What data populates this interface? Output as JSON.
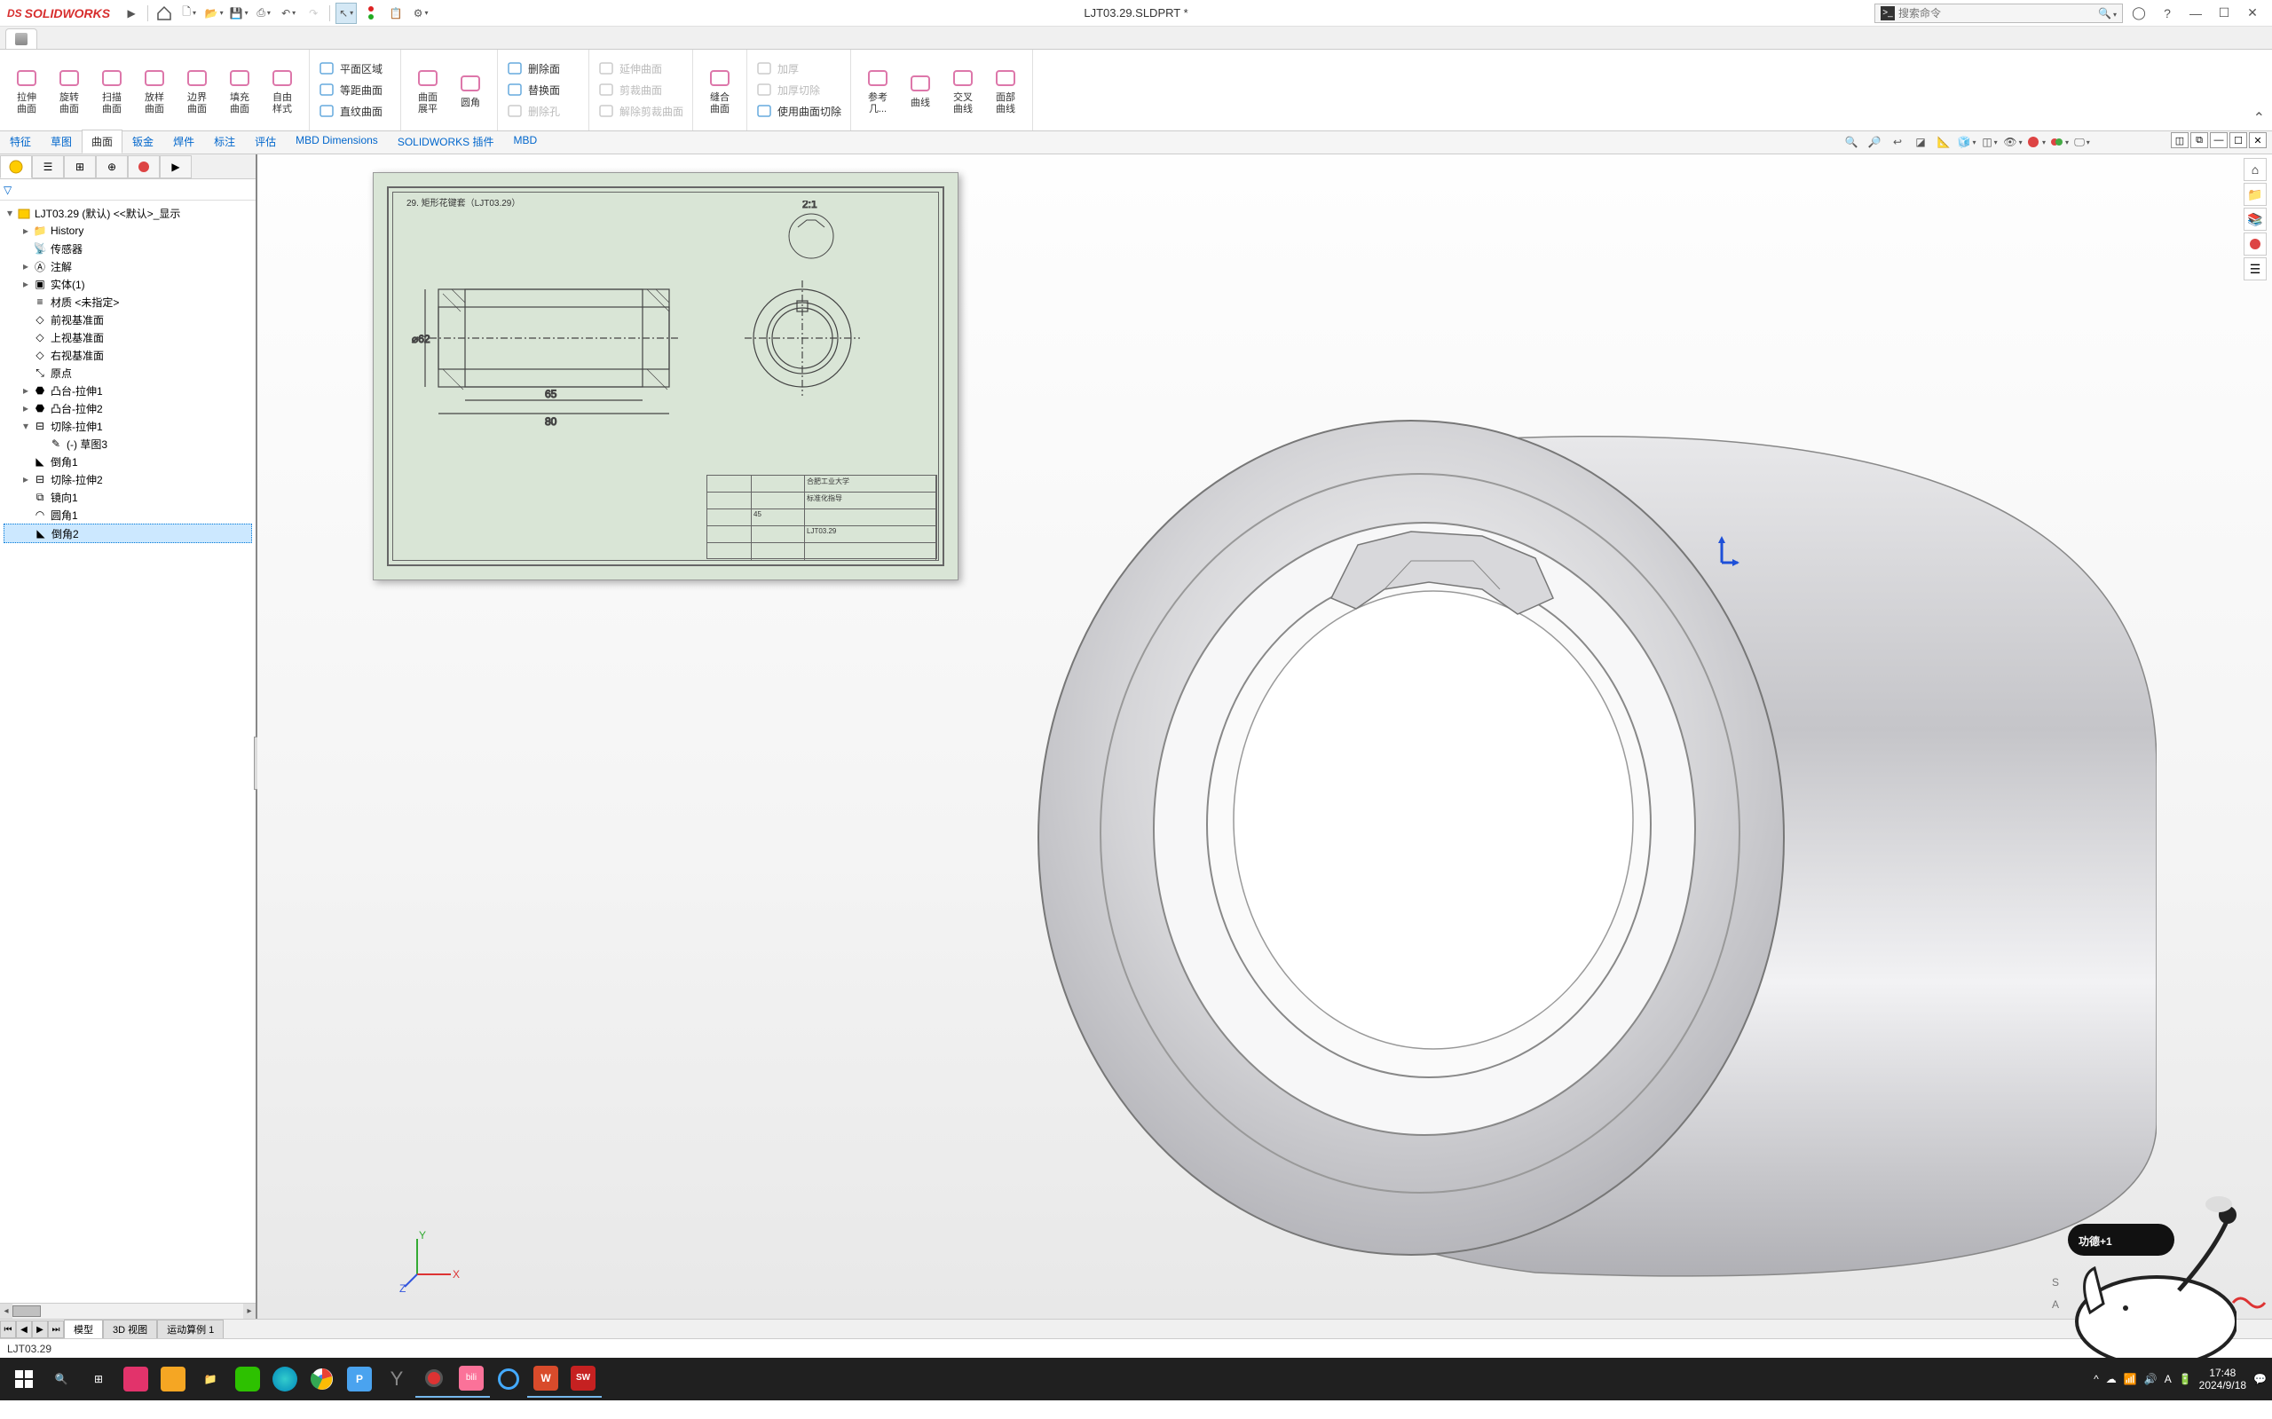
{
  "titlebar": {
    "logo_prefix": "DS",
    "logo_text": "SOLIDWORKS",
    "document_title": "LJT03.29.SLDPRT *",
    "search_placeholder": "搜索命令"
  },
  "ribbon": {
    "groups": {
      "g1": [
        {
          "label": "拉伸\n曲面"
        },
        {
          "label": "旋转\n曲面"
        },
        {
          "label": "扫描\n曲面"
        },
        {
          "label": "放样\n曲面"
        },
        {
          "label": "边界\n曲面"
        },
        {
          "label": "填充\n曲面"
        },
        {
          "label": "自由\n样式"
        }
      ],
      "g2": [
        {
          "label": "平面区域"
        },
        {
          "label": "等距曲面"
        },
        {
          "label": "直纹曲面"
        }
      ],
      "g3": [
        {
          "label": "曲面\n展平"
        },
        {
          "label": "圆角"
        }
      ],
      "g4": [
        {
          "label": "删除面"
        },
        {
          "label": "替换面"
        },
        {
          "label": "删除孔",
          "disabled": true
        }
      ],
      "g5": [
        {
          "label": "延伸曲面",
          "disabled": true
        },
        {
          "label": "剪裁曲面",
          "disabled": true
        },
        {
          "label": "解除剪裁曲面",
          "disabled": true
        }
      ],
      "g6": [
        {
          "label": "缝合\n曲面"
        }
      ],
      "g7": [
        {
          "label": "加厚",
          "disabled": true
        },
        {
          "label": "加厚切除",
          "disabled": true
        },
        {
          "label": "使用曲面切除"
        }
      ],
      "g8": [
        {
          "label": "参考\n几..."
        },
        {
          "label": "曲线"
        },
        {
          "label": "交叉\n曲线"
        },
        {
          "label": "面部\n曲线"
        }
      ]
    }
  },
  "tabs": [
    "特征",
    "草图",
    "曲面",
    "钣金",
    "焊件",
    "标注",
    "评估",
    "MBD Dimensions",
    "SOLIDWORKS 插件",
    "MBD"
  ],
  "active_tab": "曲面",
  "tree": {
    "root": "LJT03.29 (默认) <<默认>_显示",
    "items": [
      {
        "exp": "▸",
        "icon": "history",
        "label": "History"
      },
      {
        "exp": "",
        "icon": "sensor",
        "label": "传感器"
      },
      {
        "exp": "▸",
        "icon": "annot",
        "label": "注解"
      },
      {
        "exp": "▸",
        "icon": "solid",
        "label": "实体(1)"
      },
      {
        "exp": "",
        "icon": "material",
        "label": "材质 <未指定>"
      },
      {
        "exp": "",
        "icon": "plane",
        "label": "前视基准面"
      },
      {
        "exp": "",
        "icon": "plane",
        "label": "上视基准面"
      },
      {
        "exp": "",
        "icon": "plane",
        "label": "右视基准面"
      },
      {
        "exp": "",
        "icon": "origin",
        "label": "原点"
      },
      {
        "exp": "▸",
        "icon": "boss",
        "label": "凸台-拉伸1"
      },
      {
        "exp": "▸",
        "icon": "boss",
        "label": "凸台-拉伸2"
      },
      {
        "exp": "▾",
        "icon": "cut",
        "label": "切除-拉伸1"
      },
      {
        "exp": "",
        "icon": "sketch",
        "label": "(-) 草图3",
        "depth": 2
      },
      {
        "exp": "",
        "icon": "chamfer",
        "label": "倒角1",
        "depth": 1
      },
      {
        "exp": "▸",
        "icon": "cut",
        "label": "切除-拉伸2",
        "depth": 1
      },
      {
        "exp": "",
        "icon": "mirror",
        "label": "镜向1",
        "depth": 1
      },
      {
        "exp": "",
        "icon": "fillet",
        "label": "圆角1",
        "depth": 1
      },
      {
        "exp": "",
        "icon": "chamfer",
        "label": "倒角2",
        "depth": 1,
        "sel": true
      }
    ]
  },
  "bottom_tabs": [
    "模型",
    "3D 视图",
    "运动算例 1"
  ],
  "bottom_active": "模型",
  "status": {
    "left": "LJT03.29"
  },
  "drawing": {
    "title": "29. 矩形花键套（LJT03.29）"
  },
  "systray": {
    "time": "17:48",
    "date": "2024/9/18"
  },
  "cartoon": {
    "text": "功德+1"
  }
}
